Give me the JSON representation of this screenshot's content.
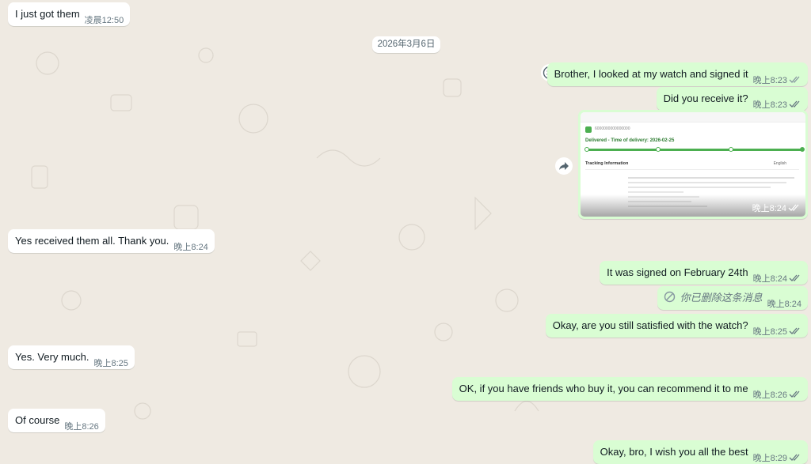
{
  "date_divider": "2026年3月6日",
  "messages": [
    {
      "dir": "in",
      "text": "I just got them",
      "time": "凌晨12:50"
    },
    {
      "dir": "out",
      "text": "Brother, I looked at my watch and signed it",
      "time": "晚上8:23"
    },
    {
      "dir": "out",
      "text": "Did you receive it?",
      "time": "晚上8:23"
    },
    {
      "dir": "out",
      "type": "image",
      "time": "晚上8:24"
    },
    {
      "dir": "in",
      "text": "Yes received them all. Thank you.",
      "time": "晚上8:24"
    },
    {
      "dir": "out",
      "text": "It was signed on February 24th",
      "time": "晚上8:24"
    },
    {
      "dir": "out",
      "text": "你已删除这条消息",
      "time": "晚上8:24",
      "deleted": true
    },
    {
      "dir": "out",
      "text": "Okay, are you still satisfied with the watch?",
      "time": "晚上8:25"
    },
    {
      "dir": "in",
      "text": "Yes. Very much.",
      "time": "晚上8:25"
    },
    {
      "dir": "out",
      "text": "OK, if you have friends who buy it, you can recommend it to me",
      "time": "晚上8:26"
    },
    {
      "dir": "in",
      "text": "Of course",
      "time": "晚上8:26"
    },
    {
      "dir": "out",
      "text": "Okay, bro, I wish you all the best",
      "time": "晚上8:29"
    }
  ],
  "screenshot": {
    "status_title": "Delivered - Time of delivery: 2026-02-25",
    "tracking_label": "Tracking Information",
    "language": "English"
  },
  "icons": {
    "emoji": "smiley-icon",
    "forward": "forward-icon",
    "deleted": "prohibited-icon",
    "ticks": "double-check-icon"
  },
  "colors": {
    "incoming": "#ffffff",
    "outgoing": "#d9fdd3",
    "tick_read": "#53bdeb",
    "background": "#efeae2"
  }
}
